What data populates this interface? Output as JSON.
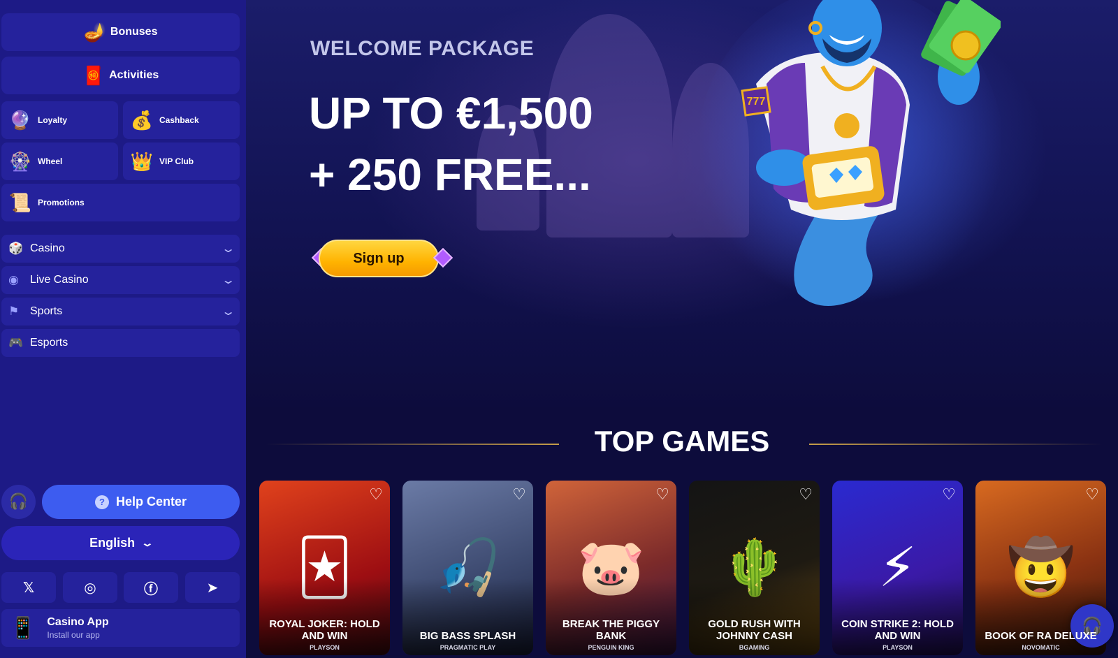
{
  "sidebar": {
    "bonuses": {
      "label": "Bonuses",
      "icon": "magic-lamp-icon"
    },
    "activities": {
      "label": "Activities",
      "icon": "flying-carpet-icon"
    },
    "tiles": [
      {
        "label": "Loyalty",
        "icon": "crystal-gem-icon"
      },
      {
        "label": "Cashback",
        "icon": "money-bag-icon"
      },
      {
        "label": "Wheel",
        "icon": "fortune-wheel-icon"
      },
      {
        "label": "VIP Club",
        "icon": "vip-crown-icon"
      },
      {
        "label": "Promotions",
        "icon": "scroll-quill-icon"
      }
    ],
    "nav": [
      {
        "label": "Casino",
        "icon": "dice-icon",
        "expandable": true
      },
      {
        "label": "Live Casino",
        "icon": "broadcast-icon",
        "expandable": true
      },
      {
        "label": "Sports",
        "icon": "flag-icon",
        "expandable": true
      },
      {
        "label": "Esports",
        "icon": "gamepad-icon",
        "expandable": false
      }
    ],
    "help_center": "Help Center",
    "language": "English",
    "socials": [
      "x-icon",
      "instagram-icon",
      "facebook-icon",
      "telegram-icon"
    ],
    "app": {
      "title": "Casino App",
      "subtitle": "Install our app"
    }
  },
  "hero": {
    "kicker": "WELCOME PACKAGE",
    "title": "UP TO €1,500\n+ 250 FREE...",
    "cta": "Sign up"
  },
  "top_games": {
    "title": "TOP GAMES",
    "games": [
      {
        "name": "ROYAL JOKER: HOLD AND WIN",
        "provider": "PLAYSON"
      },
      {
        "name": "BIG BASS SPLASH",
        "provider": "PRAGMATIC PLAY"
      },
      {
        "name": "BREAK THE PIGGY BANK",
        "provider": "PENGUIN KING"
      },
      {
        "name": "GOLD RUSH WITH JOHNNY CASH",
        "provider": "BGAMING"
      },
      {
        "name": "COIN STRIKE 2: HOLD AND WIN",
        "provider": "PLAYSON"
      },
      {
        "name": "BOOK OF RA DELUXE",
        "provider": "NOVOMATIC"
      }
    ]
  },
  "colors": {
    "sidebar_bg": "#1d1a86",
    "tile_bg": "#25229c",
    "accent_blue": "#3d5cf0",
    "cta_yellow": "#ffc107",
    "page_bg": "#0d0c3c"
  }
}
